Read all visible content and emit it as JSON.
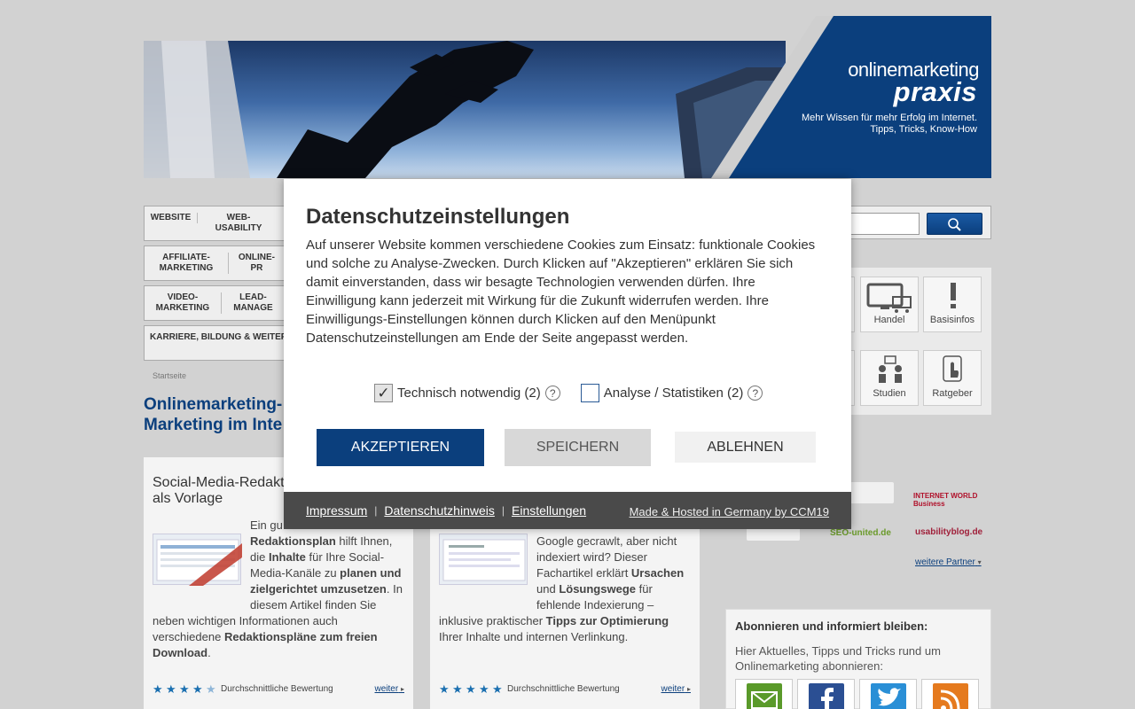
{
  "header": {
    "brand_line1": "onlinemarketing",
    "brand_line2": "praxis",
    "slogan1": "Mehr Wissen für mehr Erfolg im Internet.",
    "slogan2": "Tipps, Tricks, Know-How"
  },
  "nav": {
    "row1": [
      "WEBSITE",
      "WEB-\nUSABILITY"
    ],
    "row2": [
      "AFFILIATE-\nMARKETING",
      "ONLINE-\nPR"
    ],
    "row3": [
      "VIDEO-\nMARKETING",
      "LEAD-\nMANAGE"
    ],
    "row4": [
      "KARRIERE, BILDUNG & WEITER"
    ]
  },
  "search": {
    "placeholder": ""
  },
  "categories": {
    "handel": "Handel",
    "basisinfos": "Basisinfos",
    "studien": "Studien",
    "ratgeber": "Ratgeber"
  },
  "breadcrumb": "Startseite",
  "page_title_l1": "Onlinemarketing-",
  "page_title_l2": "Marketing im Inte",
  "cards": [
    {
      "title_l1": "Social-Media-Redakt",
      "title_l2": "als Vorlage",
      "text_p1": "Ein gu",
      "text_b1": "Redaktionsplan",
      "text_p2": " hilft Ihnen,",
      "text_p3": "die ",
      "text_b2": "Inhalte",
      "text_p4": " für Ihre Social-",
      "text_p5": "Media-Kanäle zu ",
      "text_b3": "planen und",
      "text_b4": "zielgerichtet umzusetzen",
      "text_p6": ". In",
      "text_p7": "diesem Artikel finden Sie",
      "text_p8": "neben wichtigen Informationen auch",
      "text_p9": "verschiedene ",
      "text_b5": "Redaktionspläne zum freien",
      "text_b6": "Download",
      "text_p10": ".",
      "rating_label": "Durchschnittliche Bewertung",
      "more": "weiter"
    },
    {
      "text_l1": "Google gecrawlt, aber nicht",
      "text_l2": "indexiert wird? Dieser",
      "text_l3a": "Fachartikel erklärt ",
      "text_l3b": "Ursachen",
      "text_l4a": "und ",
      "text_l4b": "Lösungswege",
      "text_l4c": " für",
      "text_l5": "fehlende Indexierung –",
      "text_l6a": "inklusive praktischer ",
      "text_l6b": "Tipps zur Optimierung",
      "text_l7": "Ihrer Inhalte und internen Verlinkung.",
      "rating_label": "Durchschnittliche Bewertung",
      "more": "weiter"
    }
  ],
  "partners": {
    "p1": "INTERNET WORLD Business",
    "p2": "SEO-united.de",
    "p3": "usabilityblog.de",
    "more": "weitere Partner"
  },
  "newsletter": {
    "heading": "Abonnieren und informiert bleiben:",
    "text": "Hier Aktuelles, Tipps und Tricks rund um Onlinemarketing abonnieren:"
  },
  "consent": {
    "title": "Datenschutzeinstellungen",
    "body": "Auf unserer Website kommen verschiedene Cookies zum Einsatz: funktionale Cookies und solche zu Analyse-Zwecken. Durch Klicken auf \"Akzeptieren\" erklären Sie sich damit einverstanden, dass wir besagte Technologien verwenden dürfen. Ihre Einwilligung kann jederzeit mit Wirkung für die Zukunft widerrufen werden. Ihre Einwilligungs-Einstellungen können durch Klicken auf den Menüpunkt Datenschutzeinstellungen am Ende der Seite angepasst werden.",
    "opt_technical": "Technisch notwendig (2)",
    "opt_analytics": "Analyse / Statistiken (2)",
    "accept": "AKZEPTIEREN",
    "save": "SPEICHERN",
    "reject": "ABLEHNEN",
    "link_impressum": "Impressum",
    "link_datenschutz": "Datenschutzhinweis",
    "link_einstellungen": "Einstellungen",
    "made_by": "Made & Hosted in Germany by CCM19"
  },
  "colors": {
    "brand_blue": "#0b3f7d",
    "background": "#d2d2d2"
  }
}
